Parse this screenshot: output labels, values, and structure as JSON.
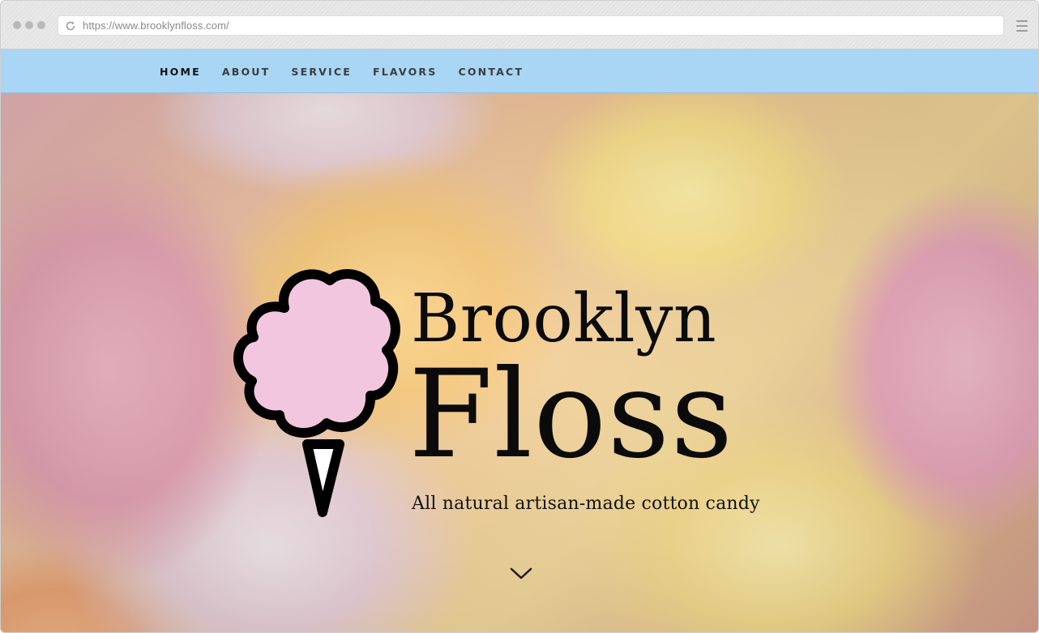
{
  "browser": {
    "url": "https://www.brooklynfloss.com/"
  },
  "nav": {
    "items": [
      {
        "label": "HOME",
        "active": true
      },
      {
        "label": "ABOUT",
        "active": false
      },
      {
        "label": "SERVICE",
        "active": false
      },
      {
        "label": "FLAVORS",
        "active": false
      },
      {
        "label": "CONTACT",
        "active": false
      }
    ]
  },
  "hero": {
    "brand_line1": "Brooklyn",
    "brand_line2": "Floss",
    "tagline": "All natural artisan-made cotton candy",
    "logo_icon": "cotton-candy-icon",
    "scroll_icon": "chevron-down-icon"
  },
  "colors": {
    "nav_background": "#a8d6f4",
    "logo_fill": "#f3c6e0",
    "text": "#0b0b0b"
  }
}
